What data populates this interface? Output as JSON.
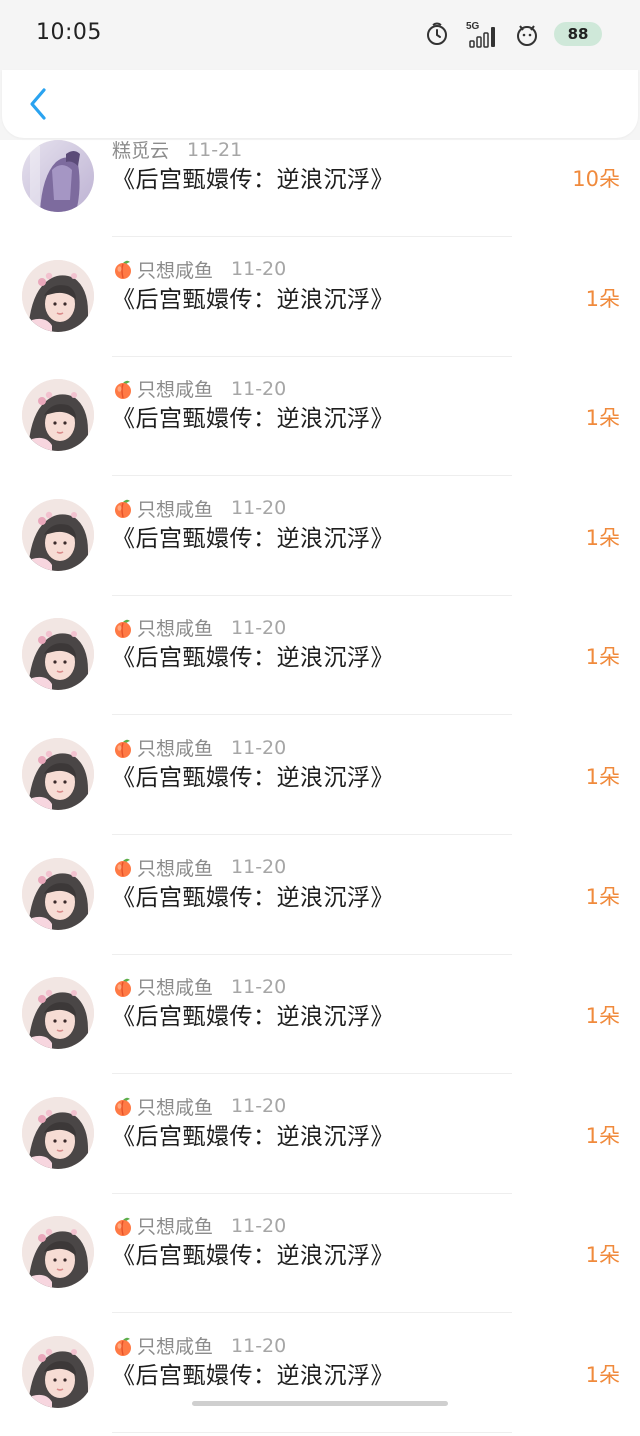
{
  "status_bar": {
    "time": "10:05",
    "signal_label": "5G",
    "battery": "88"
  },
  "header": {
    "back_icon": "chevron-left-icon",
    "accent_color": "#2aa3f0"
  },
  "gift_color": "#f08a3c",
  "items": [
    {
      "name": "糕觅云",
      "date": "11-21",
      "title": "《后宫甄嬛传：逆浪沉浮》",
      "count": "10朵",
      "has_peach": false
    },
    {
      "name": "只想咸鱼",
      "date": "11-20",
      "title": "《后宫甄嬛传：逆浪沉浮》",
      "count": "1朵",
      "has_peach": true
    },
    {
      "name": "只想咸鱼",
      "date": "11-20",
      "title": "《后宫甄嬛传：逆浪沉浮》",
      "count": "1朵",
      "has_peach": true
    },
    {
      "name": "只想咸鱼",
      "date": "11-20",
      "title": "《后宫甄嬛传：逆浪沉浮》",
      "count": "1朵",
      "has_peach": true
    },
    {
      "name": "只想咸鱼",
      "date": "11-20",
      "title": "《后宫甄嬛传：逆浪沉浮》",
      "count": "1朵",
      "has_peach": true
    },
    {
      "name": "只想咸鱼",
      "date": "11-20",
      "title": "《后宫甄嬛传：逆浪沉浮》",
      "count": "1朵",
      "has_peach": true
    },
    {
      "name": "只想咸鱼",
      "date": "11-20",
      "title": "《后宫甄嬛传：逆浪沉浮》",
      "count": "1朵",
      "has_peach": true
    },
    {
      "name": "只想咸鱼",
      "date": "11-20",
      "title": "《后宫甄嬛传：逆浪沉浮》",
      "count": "1朵",
      "has_peach": true
    },
    {
      "name": "只想咸鱼",
      "date": "11-20",
      "title": "《后宫甄嬛传：逆浪沉浮》",
      "count": "1朵",
      "has_peach": true
    },
    {
      "name": "只想咸鱼",
      "date": "11-20",
      "title": "《后宫甄嬛传：逆浪沉浮》",
      "count": "1朵",
      "has_peach": true
    },
    {
      "name": "只想咸鱼",
      "date": "11-20",
      "title": "《后宫甄嬛传：逆浪沉浮》",
      "count": "1朵",
      "has_peach": true
    }
  ]
}
